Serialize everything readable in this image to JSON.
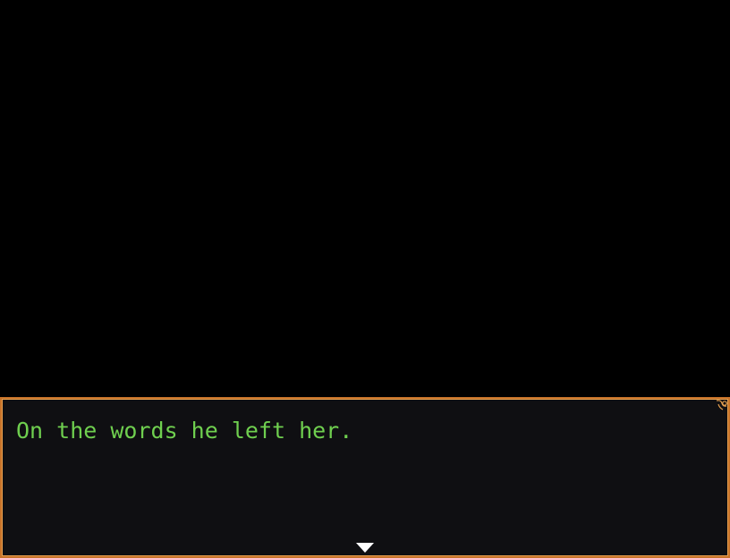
{
  "dialogue": {
    "text": "On the words he left her."
  },
  "colors": {
    "text": "#6fcf4f",
    "window_background": "#0f0f12",
    "window_border": "#c8742a",
    "cursor": "#ffffff"
  },
  "icons": {
    "continue": "down-triangle-icon",
    "ornament": "corner-ornament-icon"
  }
}
